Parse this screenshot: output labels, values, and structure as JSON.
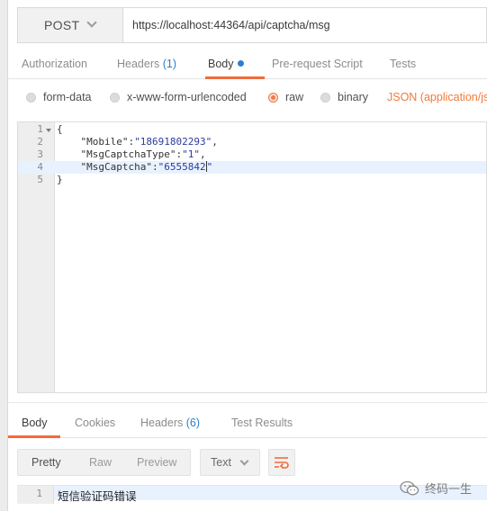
{
  "request": {
    "method": "POST",
    "url": "https://localhost:44364/api/captcha/msg"
  },
  "request_tabs": [
    {
      "label": "Authorization"
    },
    {
      "label": "Headers",
      "count": "(1)"
    },
    {
      "label": "Body"
    },
    {
      "label": "Pre-request Script"
    },
    {
      "label": "Tests"
    }
  ],
  "body_types": {
    "form_data": "form-data",
    "urlencoded": "x-www-form-urlencoded",
    "raw": "raw",
    "binary": "binary",
    "format": "JSON (application/js"
  },
  "editor": {
    "line_numbers": [
      "1",
      "2",
      "3",
      "4",
      "5"
    ],
    "lines": {
      "l1": "{",
      "l2_key": "\"Mobile\"",
      "l2_sep": ":",
      "l2_val": "\"18691802293\"",
      "l2_end": ",",
      "l3_key": "\"MsgCaptchaType\"",
      "l3_sep": ":",
      "l3_val": "\"1\"",
      "l3_end": ",",
      "l4_key": "\"MsgCaptcha\"",
      "l4_sep": ":",
      "l4_val": "\"6555842",
      "l4_end": "\"",
      "l5": "}"
    }
  },
  "response_tabs": [
    {
      "label": "Body"
    },
    {
      "label": "Cookies"
    },
    {
      "label": "Headers",
      "count": "(6)"
    },
    {
      "label": "Test Results"
    }
  ],
  "response_toolbar": {
    "pretty": "Pretty",
    "raw": "Raw",
    "preview": "Preview",
    "format": "Text"
  },
  "response_body": {
    "line_number": "1",
    "text": "短信验证码错误"
  },
  "watermark": {
    "text": "终码一生"
  },
  "colors": {
    "accent": "#f26b3a",
    "link_blue": "#2d7dca",
    "string_blue": "#2a3c9c"
  }
}
